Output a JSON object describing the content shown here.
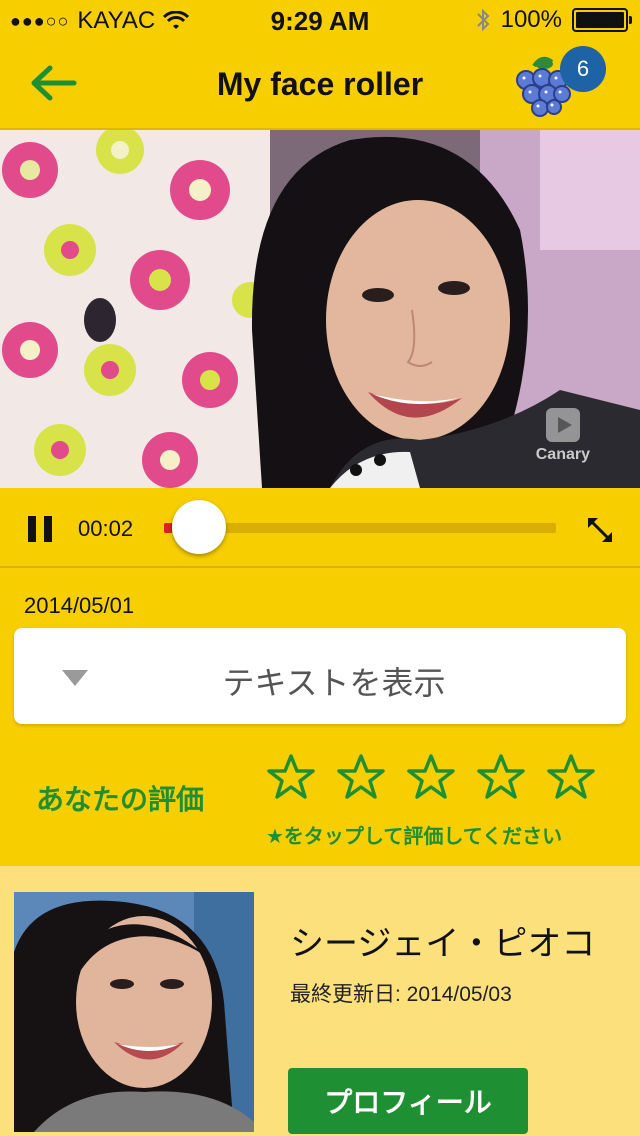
{
  "status_bar": {
    "signal": "●●●○○",
    "carrier": "KAYAC",
    "time": "9:29 AM",
    "battery_text": "100%"
  },
  "nav": {
    "title": "My face roller",
    "badge_count": "6",
    "icons": {
      "back": "back-arrow-icon",
      "grape": "grape-icon"
    }
  },
  "video": {
    "watermark": "Canary"
  },
  "player": {
    "current_time": "00:02",
    "progress_fraction": 0.02
  },
  "post": {
    "date": "2014/05/01",
    "text_toggle_label": "テキストを表示"
  },
  "rating": {
    "label": "あなたの評価",
    "hint": "★をタップして評価してください",
    "stars_filled": 0,
    "stars_total": 5
  },
  "profile": {
    "name": "シージェイ・ピオコ",
    "last_updated": "最終更新日: 2014/05/03",
    "button_label": "プロフィール"
  },
  "colors": {
    "accent_yellow": "#F7CE00",
    "accent_green": "#1F8F34",
    "badge_blue": "#1E63A6",
    "progress_red": "#E02020"
  }
}
